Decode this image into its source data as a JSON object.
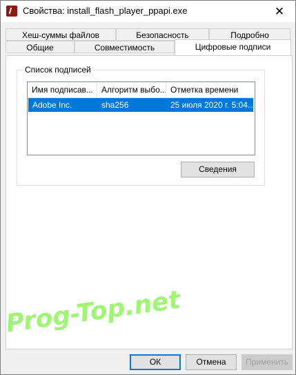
{
  "window": {
    "title": "Свойства: install_flash_player_ppapi.exe",
    "close_symbol": "✕"
  },
  "tabs_top_row": [
    "Хеш-суммы файлов",
    "Безопасность",
    "Подробно"
  ],
  "tabs_bottom_row": [
    "Общие",
    "Совместимость",
    "Цифровые подписи"
  ],
  "active_tab": "Цифровые подписи",
  "signatures": {
    "group_title": "Список подписей",
    "columns": [
      "Имя подписав...",
      "Алгоритм выбо...",
      "Отметка времени"
    ],
    "rows": [
      {
        "name": "Adobe Inc.",
        "algorithm": "sha256",
        "timestamp": "25 июля 2020 г. 5:04..."
      }
    ],
    "details_button": "Сведения"
  },
  "footer": {
    "ok": "ОК",
    "cancel": "Отмена",
    "apply": "Применить"
  },
  "watermark": "Prog-Top.net",
  "colors": {
    "selection": "#0078d7",
    "icon": "#8c1a12",
    "watermark": "#8ef55a"
  }
}
